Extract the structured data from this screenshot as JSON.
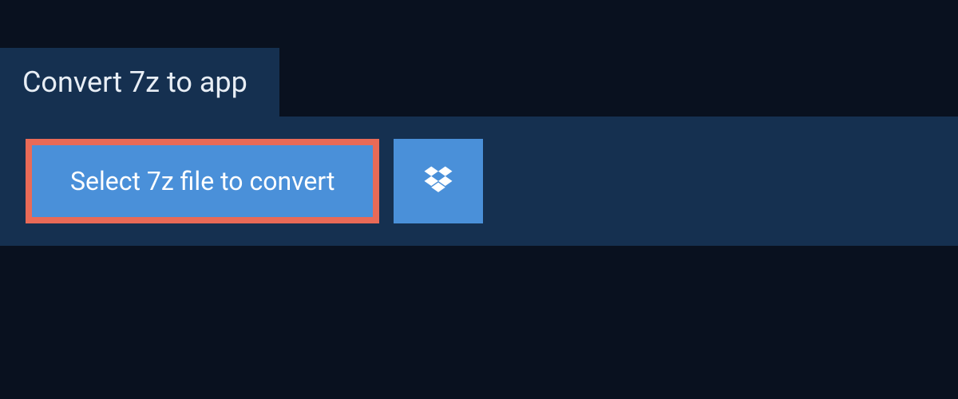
{
  "header": {
    "title": "Convert 7z to app"
  },
  "upload": {
    "select_label": "Select 7z file to convert"
  },
  "colors": {
    "page_bg": "#09111f",
    "panel_bg": "#153050",
    "button_bg": "#4a90d9",
    "highlight_border": "#e96a57",
    "text": "#e8eef5"
  }
}
